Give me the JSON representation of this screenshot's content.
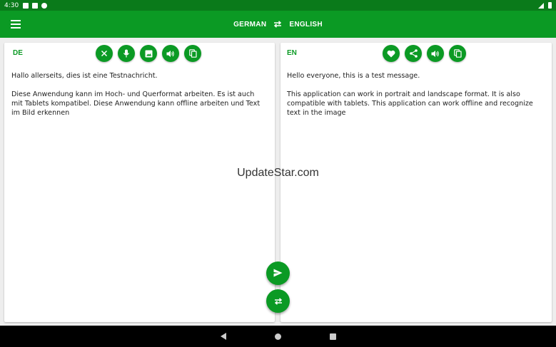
{
  "status_bar": {
    "time": "4:30",
    "icons": [
      "notification-icon",
      "sd-card-icon",
      "sync-icon",
      "signal-icon",
      "battery-icon"
    ]
  },
  "app_bar": {
    "source_language": "GERMAN",
    "target_language": "ENGLISH",
    "menu_icon": "hamburger-menu-icon",
    "swap_icon": "swap-arrows-icon",
    "color": "#0b9a24"
  },
  "source_card": {
    "lang_code": "DE",
    "text": "Hallo allerseits, dies ist eine Testnachricht.\n\nDiese Anwendung kann im Hoch- und Querformat arbeiten. Es ist auch mit Tablets kompatibel. Diese Anwendung kann offline arbeiten und Text im Bild erkennen",
    "actions": [
      "clear-icon",
      "microphone-icon",
      "image-icon",
      "speaker-icon",
      "copy-icon"
    ]
  },
  "target_card": {
    "lang_code": "EN",
    "text": "Hello everyone, this is a test message.\n\nThis application can work in portrait and landscape format. It is also compatible with tablets. This application can work offline and recognize text in the image",
    "actions": [
      "favorite-icon",
      "share-icon",
      "speaker-icon",
      "copy-icon"
    ]
  },
  "watermark": "UpdateStar.com",
  "fabs": {
    "send_icon": "send-icon",
    "swap_icon": "swap-languages-icon"
  },
  "nav_bar": {
    "buttons": [
      "back-icon",
      "home-icon",
      "recents-icon"
    ]
  }
}
